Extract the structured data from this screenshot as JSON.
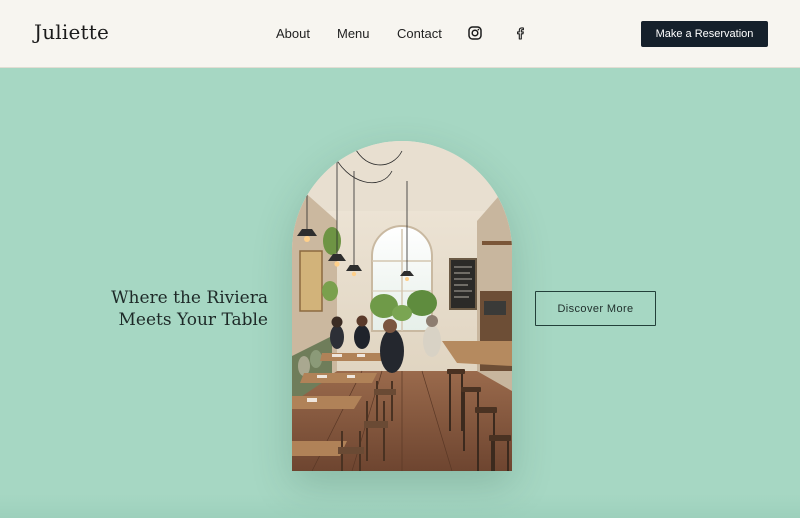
{
  "header": {
    "logo": "Juliette",
    "nav": [
      {
        "label": "About"
      },
      {
        "label": "Menu"
      },
      {
        "label": "Contact"
      }
    ],
    "social_icons": [
      "instagram-icon",
      "facebook-icon"
    ],
    "cta_label": "Make a Reservation"
  },
  "hero": {
    "tagline_line1": "Where the Riviera",
    "tagline_line2": "Meets Your Table",
    "button_label": "Discover More",
    "image_subject": "restaurant-interior-photo"
  },
  "colors": {
    "background": "#a6d7c3",
    "header_bg": "#f7f5f0",
    "cta_bg": "#15202b",
    "button_border": "#23403a"
  }
}
